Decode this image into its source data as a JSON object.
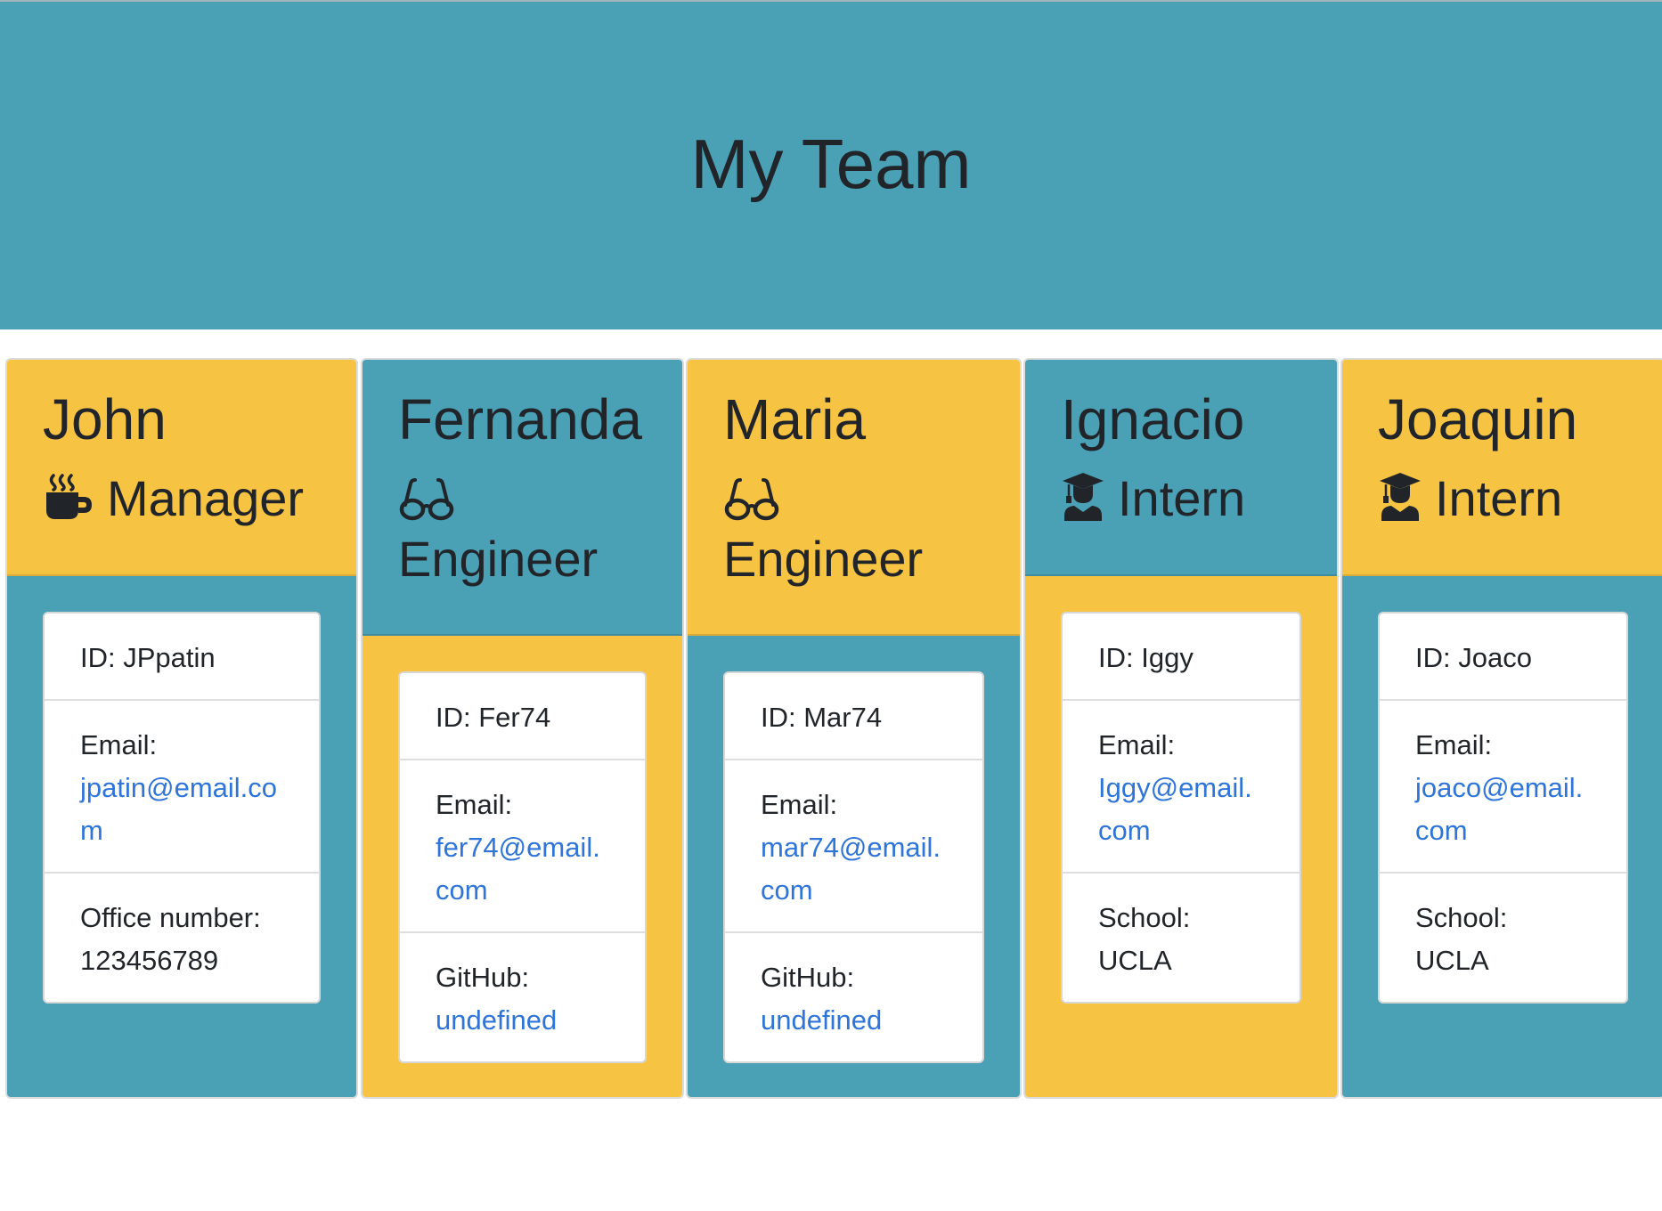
{
  "page": {
    "title": "My Team",
    "colors": {
      "header_bg": "#4aa0b5",
      "teal": "#4aa0b5",
      "yellow": "#f6c342",
      "link": "#2f74d9"
    }
  },
  "members": [
    {
      "name": "John",
      "role": "Manager",
      "role_icon": "coffee-mug-icon",
      "id_text": "ID: JPpatin",
      "email_label": "Email:",
      "email": "jpatin@email.com",
      "extra_label": "Office number:",
      "extra_value": "123456789"
    },
    {
      "name": "Fernanda",
      "role": "Engineer",
      "role_icon": "glasses-icon",
      "id_text": "ID: Fer74",
      "email_label": "Email:",
      "email": "fer74@email.com",
      "extra_label": "GitHub:",
      "extra_value": "undefined"
    },
    {
      "name": "Maria",
      "role": "Engineer",
      "role_icon": "glasses-icon",
      "id_text": "ID: Mar74",
      "email_label": "Email:",
      "email": "mar74@email.com",
      "extra_label": "GitHub:",
      "extra_value": "undefined"
    },
    {
      "name": "Ignacio",
      "role": "Intern",
      "role_icon": "graduate-icon",
      "id_text": "ID: Iggy",
      "email_label": "Email:",
      "email": "Iggy@email.com",
      "extra_label": "School:",
      "extra_value": "UCLA"
    },
    {
      "name": "Joaquin",
      "role": "Intern",
      "role_icon": "graduate-icon",
      "id_text": "ID: Joaco",
      "email_label": "Email:",
      "email": "joaco@email.com",
      "extra_label": "School:",
      "extra_value": "UCLA"
    }
  ]
}
